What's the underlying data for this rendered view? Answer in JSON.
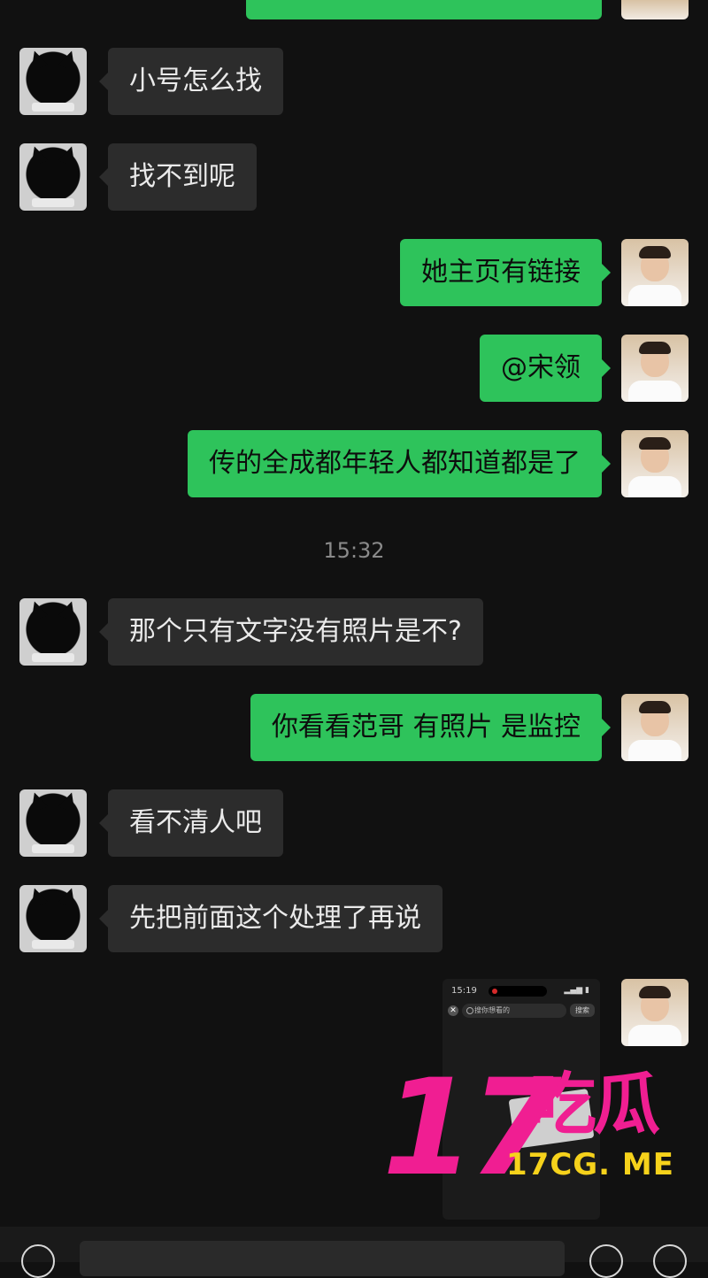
{
  "chat": {
    "messages": [
      {
        "side": "left",
        "text": "小号怎么找"
      },
      {
        "side": "left",
        "text": "找不到呢"
      },
      {
        "side": "right",
        "text": "她主页有链接"
      },
      {
        "side": "right",
        "text": "@宋领"
      },
      {
        "side": "right",
        "text": "传的全成都年轻人都知道都是了"
      },
      {
        "side": "left",
        "text": "那个只有文字没有照片是不?"
      },
      {
        "side": "right",
        "text": "你看看范哥 有照片 是监控"
      },
      {
        "side": "left",
        "text": "看不清人吧"
      },
      {
        "side": "left",
        "text": "先把前面这个处理了再说"
      }
    ],
    "timestamp": "15:32",
    "image_message": {
      "status_time": "15:19",
      "search_placeholder": "搜你想看的",
      "search_button": "搜索"
    }
  },
  "watermark": {
    "number": "17",
    "chinese": "吃瓜",
    "url": "17CG. ME"
  },
  "colors": {
    "background": "#111111",
    "incoming_bubble": "#2c2c2c",
    "outgoing_bubble": "#2ec35b",
    "watermark_pink": "#f01e92",
    "watermark_yellow": "#f6d21b"
  }
}
